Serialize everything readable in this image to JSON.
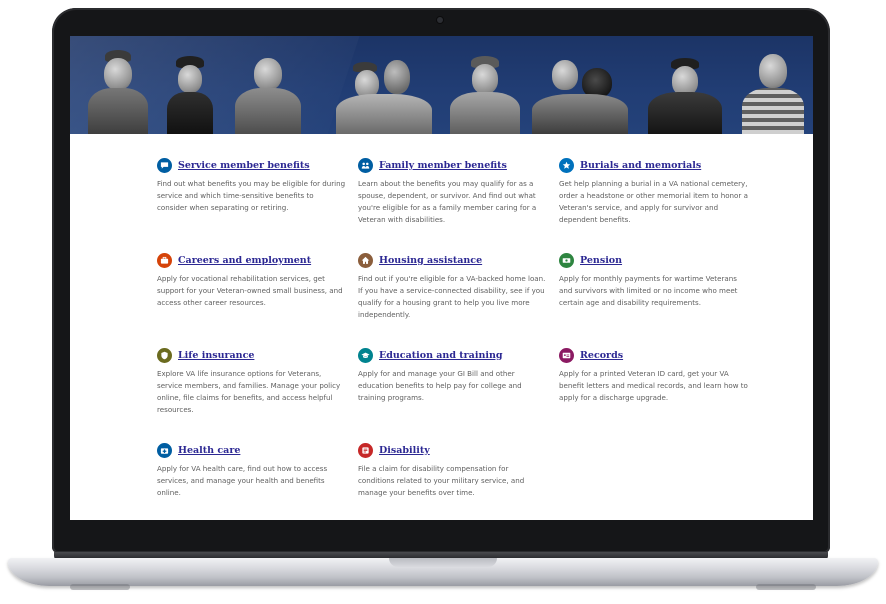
{
  "benefits": [
    {
      "title": "Service member benefits",
      "description": "Find out what benefits you may be eligible for during service and which time-sensitive benefits to consider when separating or retiring.",
      "icon": "speech-bubble-icon",
      "color": "#005ea2"
    },
    {
      "title": "Family member benefits",
      "description": "Learn about the benefits you may qualify for as a spouse, dependent, or survivor. And find out what you're eligible for as a family member caring for a Veteran with disabilities.",
      "icon": "family-icon",
      "color": "#005ea2"
    },
    {
      "title": "Burials and memorials",
      "description": "Get help planning a burial in a VA national cemetery, order a headstone or other memorial item to honor a Veteran's service, and apply for survivor and dependent benefits.",
      "icon": "star-icon",
      "color": "#0071bc"
    },
    {
      "title": "Careers and employment",
      "description": "Apply for vocational rehabilitation services, get support for your Veteran-owned small business, and access other career resources.",
      "icon": "briefcase-icon",
      "color": "#d54309"
    },
    {
      "title": "Housing assistance",
      "description": "Find out if you're eligible for a VA-backed home loan. If you have a service-connected disability, see if you qualify for a housing grant to help you live more independently.",
      "icon": "home-icon",
      "color": "#8b5e3c"
    },
    {
      "title": "Pension",
      "description": "Apply for monthly payments for wartime Veterans and survivors with limited or no income who meet certain age and disability requirements.",
      "icon": "money-icon",
      "color": "#2e8540"
    },
    {
      "title": "Life insurance",
      "description": "Explore VA life insurance options for Veterans, service members, and families. Manage your policy online, file claims for benefits, and access helpful resources.",
      "icon": "shield-icon",
      "color": "#6b6b1f"
    },
    {
      "title": "Education and training",
      "description": "Apply for and manage your GI Bill and other education benefits to help pay for college and training programs.",
      "icon": "graduation-cap-icon",
      "color": "#00838f"
    },
    {
      "title": "Records",
      "description": "Apply for a printed Veteran ID card, get your VA benefit letters and medical records, and learn how to apply for a discharge upgrade.",
      "icon": "id-card-icon",
      "color": "#8b1a62"
    },
    {
      "title": "Health care",
      "description": "Apply for VA health care, find out how to access services, and manage your health and benefits online.",
      "icon": "medkit-icon",
      "color": "#005ea2"
    },
    {
      "title": "Disability",
      "description": "File a claim for disability compensation for conditions related to your military service, and manage your benefits over time.",
      "icon": "disability-icon",
      "color": "#c62828"
    }
  ]
}
